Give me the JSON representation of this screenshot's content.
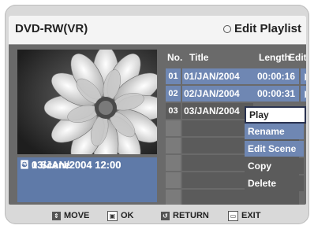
{
  "header": {
    "device": "DVD-RW(VR)",
    "screen": "Edit Playlist"
  },
  "thumbnail": {
    "desc_icon": "flower-thumbnail"
  },
  "info": {
    "date": "03/JAN/2004 12:00",
    "scenes": "1 Scene",
    "date2": "03/JAN/2004 12:00"
  },
  "table": {
    "headers": {
      "no": "No.",
      "title": "Title",
      "length": "Length",
      "edit": "Edit"
    },
    "rows": [
      {
        "no": "01",
        "title": "01/JAN/2004",
        "length": "00:00:16",
        "edit": "▶"
      },
      {
        "no": "02",
        "title": "02/JAN/2004",
        "length": "00:00:31",
        "edit": "▶"
      },
      {
        "no": "03",
        "title": "03/JAN/2004",
        "length": "",
        "edit": ""
      }
    ]
  },
  "menu": {
    "items": [
      "Play",
      "Rename",
      "Edit Scene",
      "Copy",
      "Delete"
    ],
    "selected_index": 0
  },
  "footer": {
    "move": "MOVE",
    "ok": "OK",
    "return": "RETURN",
    "exit": "EXIT"
  },
  "colors": {
    "panel": "#6a6a6a",
    "info": "#5f7aa8",
    "row_highlight": "#6f87b3",
    "row_dim": "#7b7b7b"
  }
}
